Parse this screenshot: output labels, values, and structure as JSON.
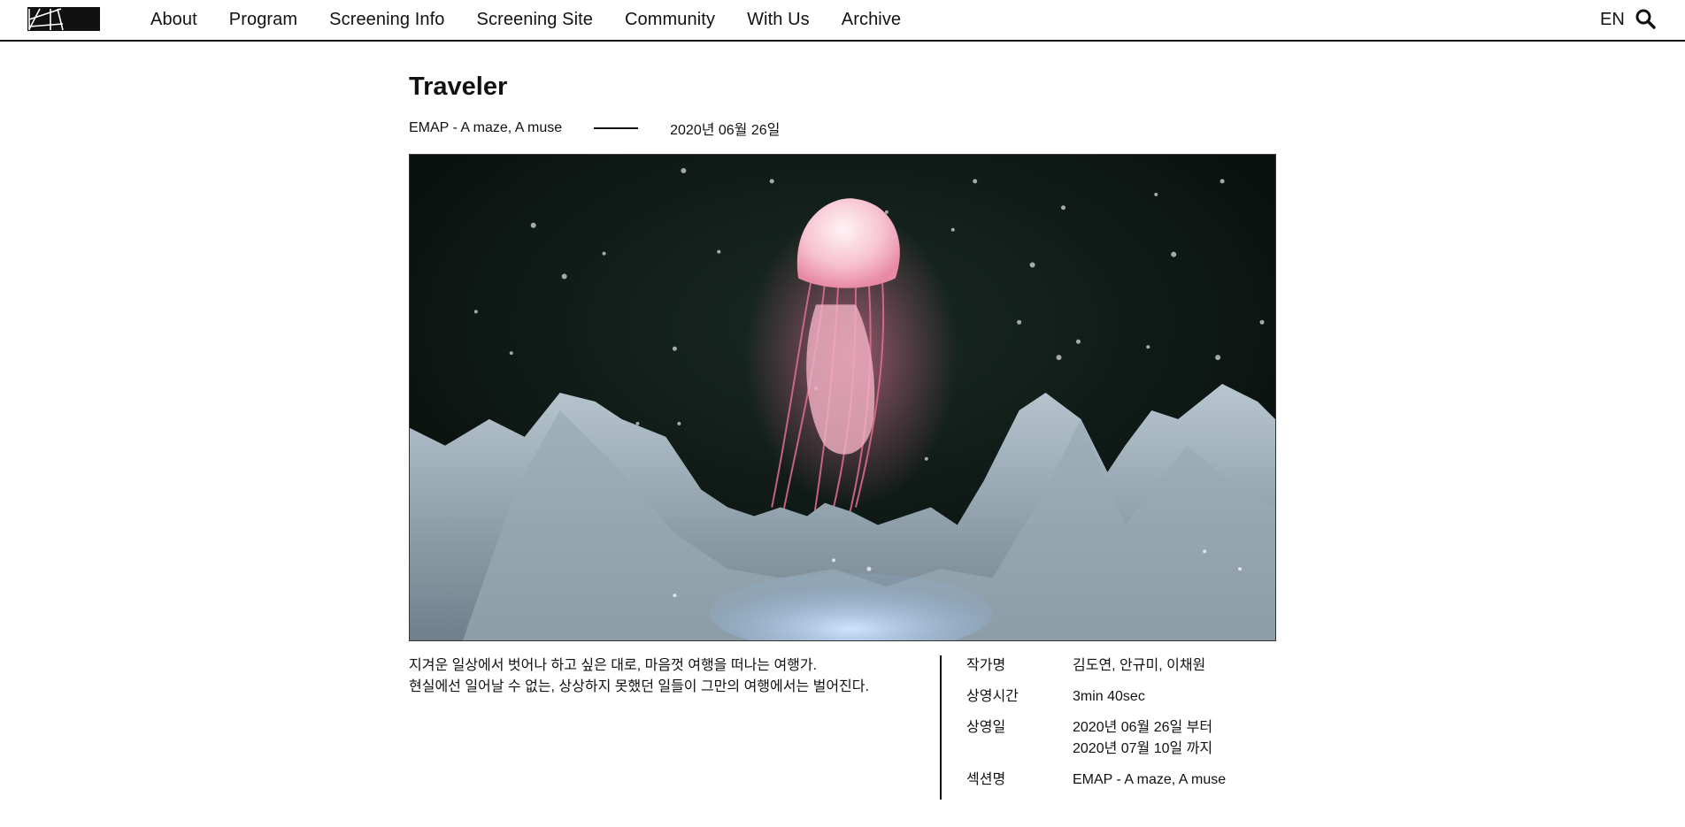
{
  "header": {
    "logo_name": "site-logo",
    "nav": [
      "About",
      "Program",
      "Screening Info",
      "Screening Site",
      "Community",
      "With Us",
      "Archive"
    ],
    "lang": "EN",
    "search_icon": "search-icon"
  },
  "work": {
    "title": "Traveler",
    "section": "EMAP - A maze, A muse",
    "date": "2020년 06월 26일",
    "image_alt": "jellyfish-over-icy-mountains",
    "description": [
      "지겨운 일상에서 벗어나 하고 싶은 대로, 마음껏 여행을 떠나는 여행가.",
      "현실에선 일어날 수 없는, 상상하지 못했던 일들이 그만의 여행에서는 벌어진다."
    ]
  },
  "info": {
    "artist_label": "작가명",
    "artist": "김도연, 안규미, 이채원",
    "runtime_label": "상영시간",
    "runtime": "3min 40sec",
    "screening_label": "상영일",
    "screening_from": "2020년 06월 26일 부터",
    "screening_to": "2020년 07월 10일 까지",
    "section_label": "섹션명",
    "section": "EMAP - A maze, A muse"
  },
  "colors": {
    "text": "#111111",
    "background": "#ffffff",
    "hero_bg": "#0d1512",
    "jellyfish": "#f6b8c8",
    "ice": "#8fa1ad"
  }
}
